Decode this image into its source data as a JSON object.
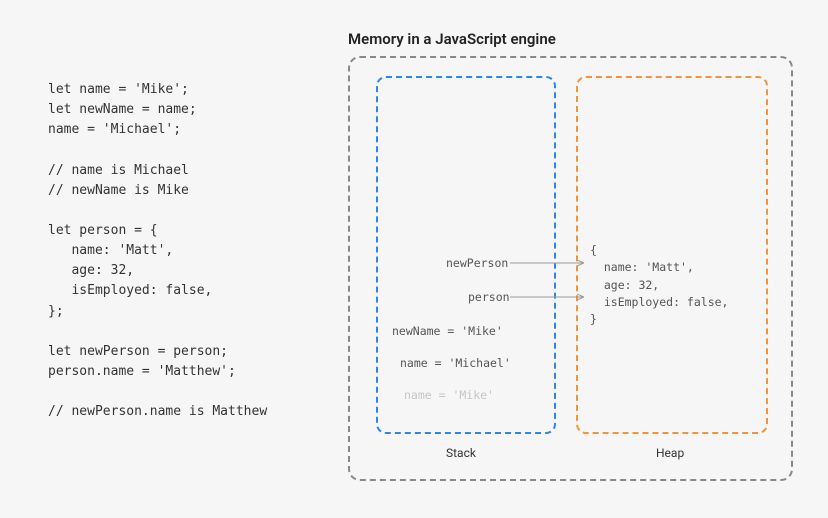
{
  "title": "Memory in a JavaScript engine",
  "code": "let name = 'Mike';\nlet newName = name;\nname = 'Michael';\n\n// name is Michael\n// newName is Mike\n\nlet person = {\n   name: 'Matt',\n   age: 32,\n   isEmployed: false,\n};\n\nlet newPerson = person;\nperson.name = 'Matthew';\n\n// newPerson.name is Matthew",
  "diagram": {
    "stack_label": "Stack",
    "heap_label": "Heap",
    "stack_items": {
      "new_person": "newPerson",
      "person": "person",
      "new_name": "newName  = 'Mike'",
      "name": "name  = 'Michael'",
      "name_old": "name  = 'Mike'"
    },
    "heap_object": "{\n  name: 'Matt',\n  age: 32,\n  isEmployed: false,\n}",
    "colors": {
      "stack_border": "#2b88ea",
      "heap_border": "#f0953e",
      "outer_border": "#888"
    }
  }
}
